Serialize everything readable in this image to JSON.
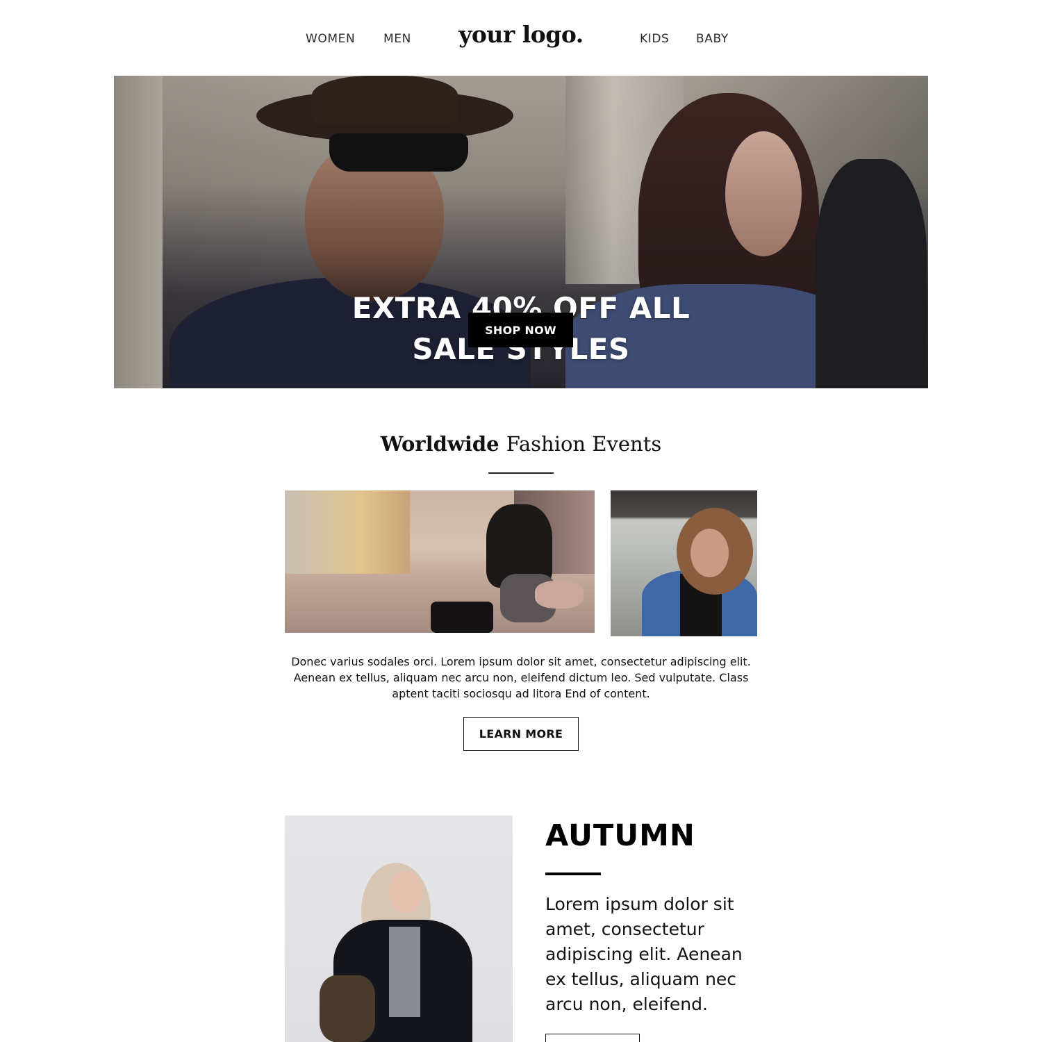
{
  "header": {
    "nav_left": [
      "WOMEN",
      "MEN"
    ],
    "logo": "your logo.",
    "nav_right": [
      "KIDS",
      "BABY"
    ]
  },
  "hero": {
    "headline_line1": "EXTRA 40% OFF ALL",
    "headline_line2": "SALE STYLES",
    "button_label": "SHOP NOW"
  },
  "events": {
    "title_bold": "Worldwide",
    "title_light": "Fashion Events",
    "body": "Donec varius sodales orci. Lorem ipsum dolor sit amet, consectetur adipiscing elit. Aenean ex tellus, aliquam nec arcu non, eleifend dictum leo. Sed vulputate. Class aptent taciti sociosqu ad litora End of content.",
    "button_label": "LEARN MORE"
  },
  "autumn": {
    "title": "AUTUMN",
    "body": "Lorem ipsum dolor sit amet, consectetur adipiscing elit. Aenean ex tellus, aliquam nec arcu non, eleifend.",
    "button_label": ""
  },
  "colors": {
    "accent": "#000000",
    "background": "#ffffff",
    "text": "#111111"
  }
}
